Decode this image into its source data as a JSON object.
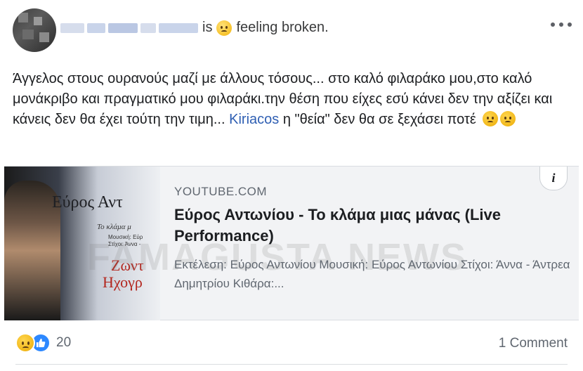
{
  "post": {
    "status_verb": "is",
    "feeling_emoji": "pensive-face-emoji",
    "feeling_text": "feeling broken.",
    "more_icon": "more-horizontal-icon",
    "text_main": "Άγγελος στους ουρανούς μαζί με άλλους τόσους... στο καλό φιλαράκο μου,στο καλό μονάκριβο και πραγματικό μου φιλαράκι.την θέση που είχες εσύ κάνει δεν την αξίζει και κάνεις δεν θα έχει τούτη την τιμη...",
    "mention": "Kiriacos",
    "text_after_mention": "η \"θεία\" δεν θα σε ξεχάσει ποτέ"
  },
  "link": {
    "domain": "YOUTUBE.COM",
    "title": "Εύρος Αντωνίου - Το κλάμα μιας μάνας (Live Performance)",
    "description": "Εκτέλεση: Εύρος Αντωνίου Μουσική: Εύρος Αντωνίου Στίχοι: Άννα - Άντρεα Δημητρίου Κιθάρα:...",
    "info_label": "i",
    "thumbnail": {
      "line1": "Εύρος Αντ",
      "line2": "Το κλάμα μ",
      "line3": "Μουσική: Εύρ",
      "line4": "Στίχοι: Άννα -",
      "line5": "Ζωντ",
      "line6": "Ηχογρ"
    },
    "watermark": "FAMAGUSTA NEWS"
  },
  "footer": {
    "reaction_count": "20",
    "comments_label": "1 Comment"
  },
  "colors": {
    "link": "#2f5fb3",
    "like_blue": "#2d88ff",
    "secondary_text": "#606770"
  }
}
